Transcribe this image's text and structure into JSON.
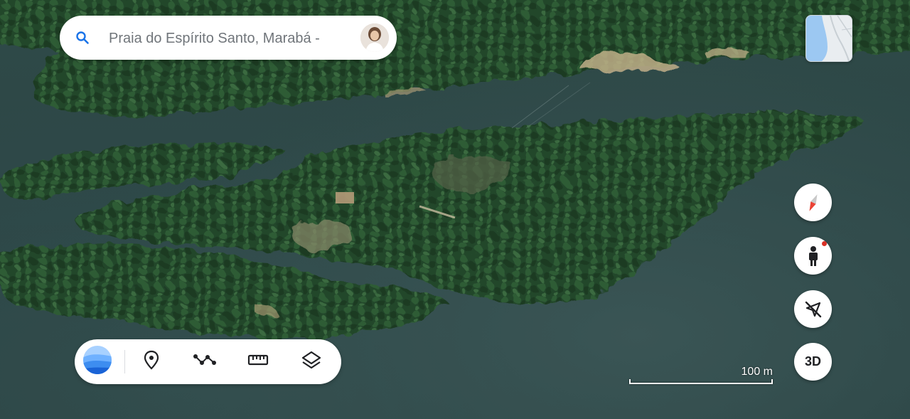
{
  "search": {
    "placeholder": "Praia do Espírito Santo, Marabá -",
    "icon": "search-icon"
  },
  "account": {
    "icon": "avatar"
  },
  "minimap": {
    "icon": "minimap-thumbnail"
  },
  "right_controls": {
    "compass_icon": "compass-icon",
    "street_view_icon": "pegman-icon",
    "location_icon": "location-off-icon",
    "view_3d_label": "3D"
  },
  "toolbar": {
    "items": [
      {
        "icon": "earth-logo-icon"
      },
      {
        "icon": "place-marker-icon"
      },
      {
        "icon": "draw-path-icon"
      },
      {
        "icon": "measure-ruler-icon"
      },
      {
        "icon": "layers-icon"
      }
    ]
  },
  "scale": {
    "label": "100 m"
  },
  "colors": {
    "water": "#2d4646",
    "forest": "#24472c",
    "accent_red": "#d93025",
    "earth_blue": "#4285f4"
  }
}
